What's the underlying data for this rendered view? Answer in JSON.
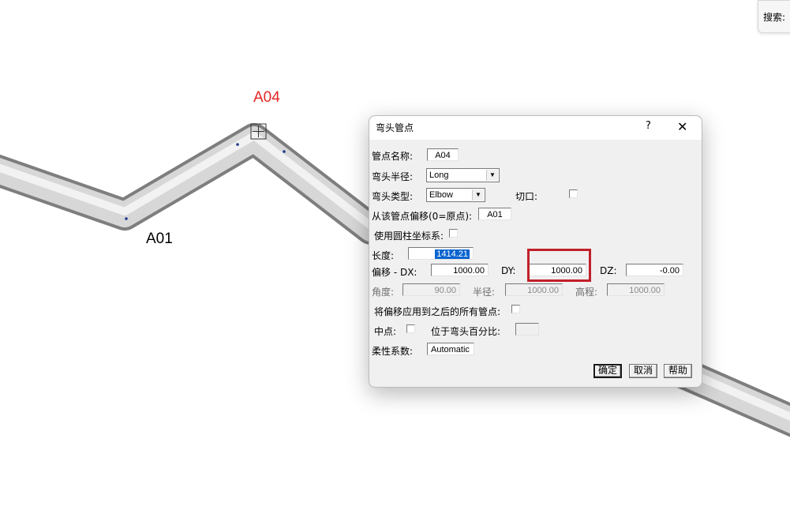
{
  "viewport": {
    "node_labels": [
      {
        "text": "A04",
        "color": "#e32626"
      },
      {
        "text": "A01",
        "color": "#000000"
      }
    ],
    "search_label": "搜索:"
  },
  "dialog": {
    "title": "弯头管点",
    "help_glyph": "?",
    "close_glyph": "✕",
    "node_name_label": "管点名称:",
    "node_name": "A04",
    "bend_radius_label": "弯头半径:",
    "bend_radius": "Long",
    "bend_type_label": "弯头类型:",
    "bend_type": "Elbow",
    "cut_label": "切口:",
    "offset_from_label": "从该管点偏移(0=原点):",
    "offset_from": "A01",
    "cylindrical_label": "使用圆柱坐标系:",
    "length_label": "长度:",
    "length": "1414.21",
    "offset_dx_label": "偏移 - DX:",
    "dx": "1000.00",
    "dy_label": "DY:",
    "dy": "1000.00",
    "dz_label": "DZ:",
    "dz": "-0.00",
    "angle_label": "角度:",
    "angle": "90.00",
    "radius_label": "半径:",
    "radius": "1000.00",
    "elevation_label": "高程:",
    "elevation": "1000.00",
    "apply_all_label": "将偏移应用到之后的所有管点:",
    "midpoint_label": "中点:",
    "percent_label": "位于弯头百分比:",
    "percent": "",
    "flex_label": "柔性系数:",
    "flex": "Automatic",
    "ok_label": "确定",
    "cancel_label": "取消",
    "help_label": "帮助"
  },
  "colors": {
    "highlight": "#c0202a",
    "selection": "#0a64d0"
  }
}
